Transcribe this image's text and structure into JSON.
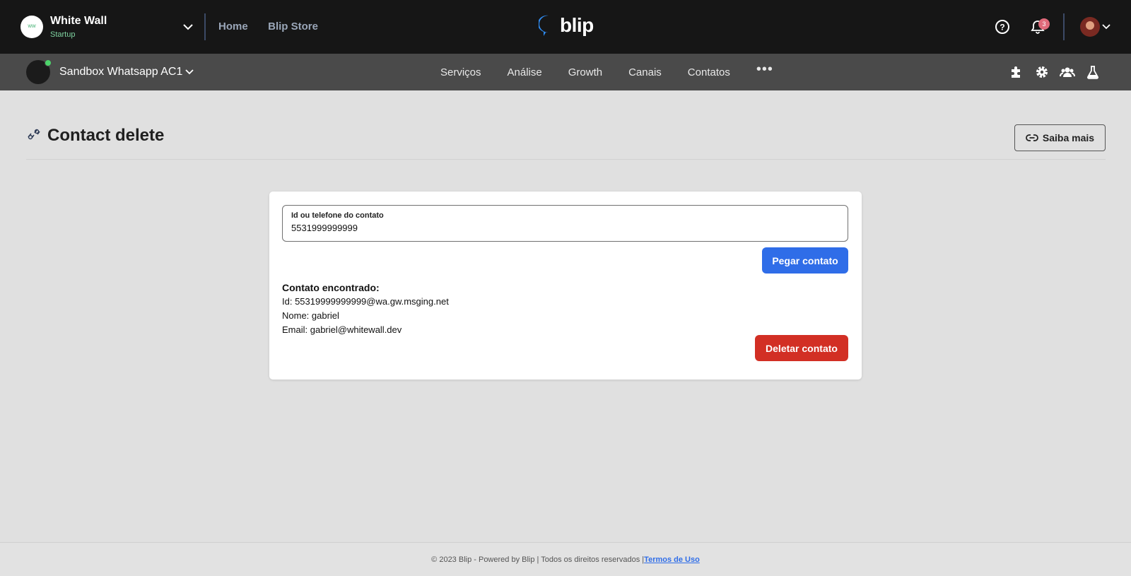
{
  "topbar": {
    "org_name": "White Wall",
    "org_plan": "Startup",
    "nav": [
      "Home",
      "Blip Store"
    ],
    "logo_text": "blip",
    "notification_count": "3",
    "icons": [
      "help-icon",
      "bell-icon",
      "user-avatar",
      "chevron-down-icon"
    ]
  },
  "subbar": {
    "bot_name": "Sandbox Whatsapp AC1",
    "nav": [
      "Serviços",
      "Análise",
      "Growth",
      "Canais",
      "Contatos"
    ],
    "more": "•••",
    "icons": [
      "puzzle-icon",
      "gear-icon",
      "users-icon",
      "flask-icon"
    ]
  },
  "page": {
    "title": "Contact delete",
    "help_button": "Saiba mais"
  },
  "form": {
    "label": "Id ou telefone do contato",
    "value": "5531999999999",
    "get_button": "Pegar contato"
  },
  "result": {
    "heading": "Contato encontrado:",
    "id": "Id: 55319999999999@wa.gw.msging.net",
    "name": "Nome: gabriel",
    "email": "Email: gabriel@whitewall.dev",
    "delete_button": "Deletar contato"
  },
  "footer": {
    "text": "© 2023 Blip - Powered by Blip | Todos os direitos reservados | ",
    "link": "Termos de Uso"
  },
  "colors": {
    "primary": "#2f6de8",
    "danger": "#d22f24",
    "topbar": "#161616",
    "subbar": "#4a4a4a"
  }
}
